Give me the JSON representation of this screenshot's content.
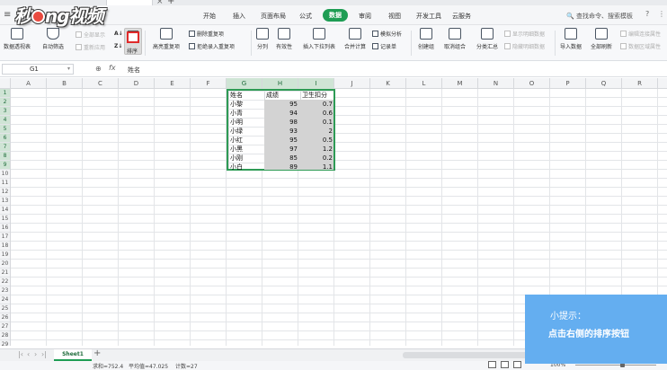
{
  "watermark": {
    "text_a": "秒",
    "text_b": "ng视频"
  },
  "menu": {
    "items": [
      "开始",
      "插入",
      "页面布局",
      "公式",
      "数据",
      "审阅",
      "视图",
      "开发工具",
      "云服务"
    ],
    "active": "数据",
    "search": "查找命令、搜索模板"
  },
  "ribbon": {
    "pivot": "数据透视表",
    "autofilter": "自动筛选",
    "show_all": "全部显示",
    "reapply": "重新应用",
    "sort": "排序",
    "highlight_dup": "高亮重复项",
    "remove_dup": "删除重复项",
    "reject_dup": "拒绝录入重复项",
    "split": "分列",
    "validity": "有效性",
    "insert_dropdown": "插入下拉列表",
    "consolidate": "合并计算",
    "simulate": "模拟分析",
    "record": "记录单",
    "group": "创建组",
    "ungroup": "取消组合",
    "subtotal": "分类汇总",
    "show_detail": "显示明细数据",
    "hide_detail": "隐藏明细数据",
    "import": "导入数据",
    "refresh_all": "全部刷新",
    "edit_links": "编辑连接属性",
    "data_region": "数据区域属性"
  },
  "formula_bar": {
    "cell_ref": "G1",
    "fx": "fx",
    "value": "姓名"
  },
  "grid": {
    "columns": [
      "A",
      "B",
      "C",
      "D",
      "E",
      "F",
      "G",
      "H",
      "I",
      "J",
      "K",
      "L",
      "M",
      "N",
      "O",
      "P",
      "Q",
      "R"
    ],
    "rows": [
      "1",
      "2",
      "3",
      "4",
      "5",
      "6",
      "7",
      "8",
      "9",
      "10",
      "11",
      "12",
      "13",
      "14",
      "15",
      "16",
      "17",
      "18",
      "19",
      "20",
      "21",
      "22",
      "23",
      "24",
      "25",
      "26",
      "27",
      "28",
      "29"
    ]
  },
  "table": {
    "headers": [
      "姓名",
      "成绩",
      "卫生扣分"
    ],
    "rows": [
      [
        "小黎",
        "95",
        "0.7"
      ],
      [
        "小青",
        "94",
        "0.6"
      ],
      [
        "小明",
        "98",
        "0.1"
      ],
      [
        "小绿",
        "93",
        "2"
      ],
      [
        "小红",
        "95",
        "0.5"
      ],
      [
        "小黑",
        "97",
        "1.2"
      ],
      [
        "小刚",
        "85",
        "0.2"
      ],
      [
        "小白",
        "89",
        "1.1"
      ]
    ]
  },
  "sheets": {
    "tabs": [
      "Sheet1"
    ],
    "add": "+"
  },
  "status": {
    "sum": "求和=752.4",
    "avg": "平均值=47.025",
    "count": "计数=27",
    "zoom": "100%"
  },
  "tip": {
    "title": "小提示：",
    "body": "点击右侧的排序按钮"
  },
  "colors": {
    "accent": "#1e9d54",
    "selection_border": "#2e9b55",
    "tip_bg": "#64aef0",
    "highlight": "#e02a2a"
  }
}
